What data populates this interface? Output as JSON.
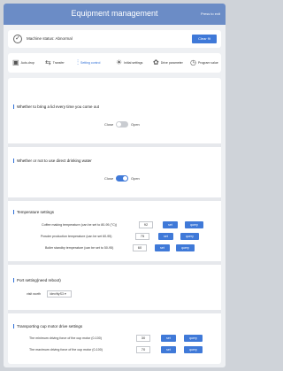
{
  "header": {
    "title": "Equipment management",
    "exit_label": "Press to exit"
  },
  "status": {
    "text": "Machine status: Abnormal",
    "clear_label": "Clear flt"
  },
  "tabs": [
    {
      "label": "Auto-drop",
      "icon": "box-icon"
    },
    {
      "label": "Transfer",
      "icon": "transfer-icon"
    },
    {
      "label": "Setting control",
      "icon": "sliders-icon"
    },
    {
      "label": "Initial settings",
      "icon": "bulb-icon"
    },
    {
      "label": "Drive parameter",
      "icon": "gear-icon"
    },
    {
      "label": "Program value",
      "icon": "dial-icon"
    }
  ],
  "lid": {
    "title": "Whether to bring a lid every time you come out",
    "close": "Close",
    "open": "Open",
    "state": "off"
  },
  "water": {
    "title": "Whether or not to use direct drinking water",
    "close": "Close",
    "open": "Open",
    "state": "on"
  },
  "temps": {
    "title": "Temperature settings",
    "rows": [
      {
        "label": "Coffee making temperature (can be set to 80-95 (°C))",
        "value": "92",
        "set": "set",
        "query": "query"
      },
      {
        "label": "Powder production temperature (can be set 60-95)",
        "value": "75",
        "set": "set",
        "query": "query"
      },
      {
        "label": "Boiler standby temperature (can be set to 50-95)",
        "value": "60",
        "set": "set",
        "query": "query"
      }
    ]
  },
  "port": {
    "title": "Port setting(need reboot)",
    "label": "visit worth",
    "value": "/dev/ttyS3 ▾"
  },
  "cup": {
    "title": "Transporting cup motor drive settings",
    "rows": [
      {
        "label": "The minimum driving force of the cup motor (0-100)",
        "value": "30",
        "set": "set",
        "query": "query"
      },
      {
        "label": "The maximum driving force of the cup motor (0-100)",
        "value": "70",
        "set": "set",
        "query": "query"
      }
    ]
  }
}
